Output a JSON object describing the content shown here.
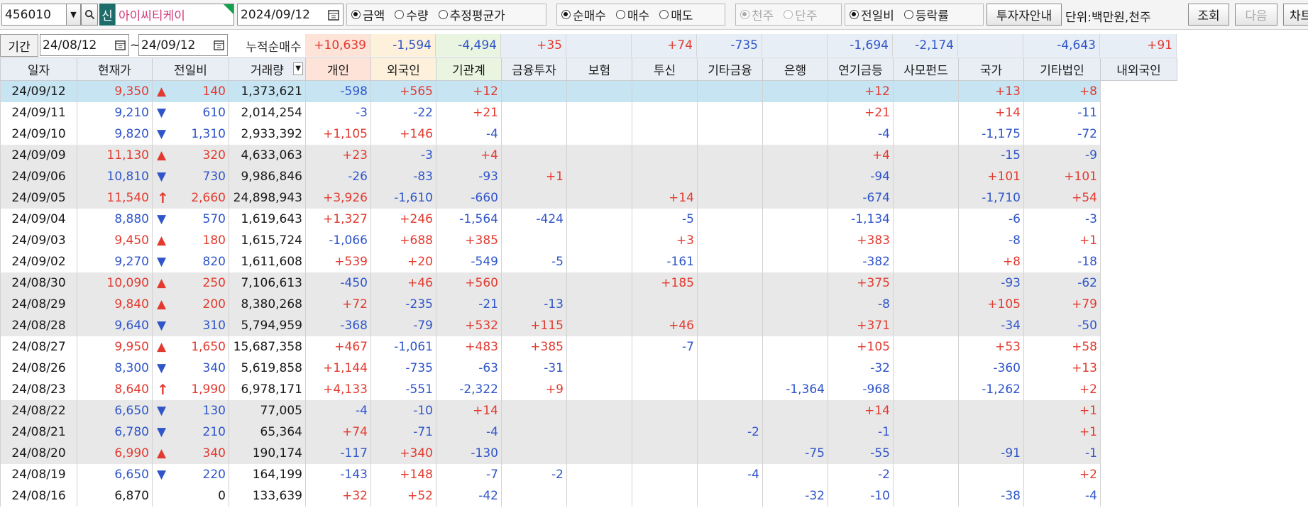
{
  "toolbar": {
    "code": "456010",
    "new_badge": "신",
    "name": "아이씨티케이",
    "date": "2024/09/12",
    "group1": [
      "금액",
      "수량",
      "추정평균가"
    ],
    "group2": [
      "순매수",
      "매수",
      "매도"
    ],
    "group3": [
      "천주",
      "단주"
    ],
    "group4": [
      "전일비",
      "등락률"
    ],
    "invest_btn": "투자자안내",
    "unit": "단위:백만원,천주",
    "query_btn": "조회",
    "next_btn": "다음",
    "chart_btn": "차트"
  },
  "period": {
    "label": "기간",
    "from": "24/08/12",
    "sep": "~",
    "to": "24/09/12",
    "cum_label": "누적순매수"
  },
  "cumulative": [
    "+10,639",
    "-1,594",
    "-4,494",
    "+35",
    "",
    "+74",
    "-735",
    "",
    "-1,694",
    "-2,174",
    "",
    "-4,643",
    "+91"
  ],
  "columns": [
    "일자",
    "현재가",
    "전일비",
    "거래량",
    "개인",
    "외국인",
    "기관계",
    "금융투자",
    "보험",
    "투신",
    "기타금융",
    "은행",
    "연기금등",
    "사모펀드",
    "국가",
    "기타법인",
    "내외국인"
  ],
  "rows": [
    {
      "date": "24/09/12",
      "price": "9,350",
      "dir": "up",
      "chg": "140",
      "vol": "1,373,621",
      "v": [
        "-598",
        "+565",
        "+12",
        "",
        "",
        "",
        "",
        "",
        "+12",
        "",
        "+13",
        "+8"
      ]
    },
    {
      "date": "24/09/11",
      "price": "9,210",
      "dir": "down",
      "chg": "610",
      "vol": "2,014,254",
      "v": [
        "-3",
        "-22",
        "+21",
        "",
        "",
        "",
        "",
        "",
        "+21",
        "",
        "+14",
        "-11"
      ]
    },
    {
      "date": "24/09/10",
      "price": "9,820",
      "dir": "down",
      "chg": "1,310",
      "vol": "2,933,392",
      "v": [
        "+1,105",
        "+146",
        "-4",
        "",
        "",
        "",
        "",
        "",
        "-4",
        "",
        "-1,175",
        "-72"
      ]
    },
    {
      "date": "24/09/09",
      "price": "11,130",
      "dir": "up",
      "chg": "320",
      "vol": "4,633,063",
      "v": [
        "+23",
        "-3",
        "+4",
        "",
        "",
        "",
        "",
        "",
        "+4",
        "",
        "-15",
        "-9"
      ]
    },
    {
      "date": "24/09/06",
      "price": "10,810",
      "dir": "down",
      "chg": "730",
      "vol": "9,986,846",
      "v": [
        "-26",
        "-83",
        "-93",
        "+1",
        "",
        "",
        "",
        "",
        "-94",
        "",
        "+101",
        "+101"
      ]
    },
    {
      "date": "24/09/05",
      "price": "11,540",
      "dir": "limitup",
      "chg": "2,660",
      "vol": "24,898,943",
      "v": [
        "+3,926",
        "-1,610",
        "-660",
        "",
        "",
        "+14",
        "",
        "",
        "-674",
        "",
        "-1,710",
        "+54"
      ]
    },
    {
      "date": "24/09/04",
      "price": "8,880",
      "dir": "down",
      "chg": "570",
      "vol": "1,619,643",
      "v": [
        "+1,327",
        "+246",
        "-1,564",
        "-424",
        "",
        "-5",
        "",
        "",
        "-1,134",
        "",
        "-6",
        "-3"
      ]
    },
    {
      "date": "24/09/03",
      "price": "9,450",
      "dir": "up",
      "chg": "180",
      "vol": "1,615,724",
      "v": [
        "-1,066",
        "+688",
        "+385",
        "",
        "",
        "+3",
        "",
        "",
        "+383",
        "",
        "-8",
        "+1"
      ]
    },
    {
      "date": "24/09/02",
      "price": "9,270",
      "dir": "down",
      "chg": "820",
      "vol": "1,611,608",
      "v": [
        "+539",
        "+20",
        "-549",
        "-5",
        "",
        "-161",
        "",
        "",
        "-382",
        "",
        "+8",
        "-18"
      ]
    },
    {
      "date": "24/08/30",
      "price": "10,090",
      "dir": "up",
      "chg": "250",
      "vol": "7,106,613",
      "v": [
        "-450",
        "+46",
        "+560",
        "",
        "",
        "+185",
        "",
        "",
        "+375",
        "",
        "-93",
        "-62"
      ]
    },
    {
      "date": "24/08/29",
      "price": "9,840",
      "dir": "up",
      "chg": "200",
      "vol": "8,380,268",
      "v": [
        "+72",
        "-235",
        "-21",
        "-13",
        "",
        "",
        "",
        "",
        "-8",
        "",
        "+105",
        "+79"
      ]
    },
    {
      "date": "24/08/28",
      "price": "9,640",
      "dir": "down",
      "chg": "310",
      "vol": "5,794,959",
      "v": [
        "-368",
        "-79",
        "+532",
        "+115",
        "",
        "+46",
        "",
        "",
        "+371",
        "",
        "-34",
        "-50"
      ]
    },
    {
      "date": "24/08/27",
      "price": "9,950",
      "dir": "up",
      "chg": "1,650",
      "vol": "15,687,358",
      "v": [
        "+467",
        "-1,061",
        "+483",
        "+385",
        "",
        "-7",
        "",
        "",
        "+105",
        "",
        "+53",
        "+58"
      ]
    },
    {
      "date": "24/08/26",
      "price": "8,300",
      "dir": "down",
      "chg": "340",
      "vol": "5,619,858",
      "v": [
        "+1,144",
        "-735",
        "-63",
        "-31",
        "",
        "",
        "",
        "",
        "-32",
        "",
        "-360",
        "+13"
      ]
    },
    {
      "date": "24/08/23",
      "price": "8,640",
      "dir": "limitup",
      "chg": "1,990",
      "vol": "6,978,171",
      "v": [
        "+4,133",
        "-551",
        "-2,322",
        "+9",
        "",
        "",
        "",
        "-1,364",
        "-968",
        "",
        "-1,262",
        "+2"
      ]
    },
    {
      "date": "24/08/22",
      "price": "6,650",
      "dir": "down",
      "chg": "130",
      "vol": "77,005",
      "v": [
        "-4",
        "-10",
        "+14",
        "",
        "",
        "",
        "",
        "",
        "+14",
        "",
        "",
        "+1"
      ]
    },
    {
      "date": "24/08/21",
      "price": "6,780",
      "dir": "down",
      "chg": "210",
      "vol": "65,364",
      "v": [
        "+74",
        "-71",
        "-4",
        "",
        "",
        "",
        "-2",
        "",
        "-1",
        "",
        "",
        "+1"
      ]
    },
    {
      "date": "24/08/20",
      "price": "6,990",
      "dir": "up",
      "chg": "340",
      "vol": "190,174",
      "v": [
        "-117",
        "+340",
        "-130",
        "",
        "",
        "",
        "",
        "-75",
        "-55",
        "",
        "-91",
        "-1"
      ]
    },
    {
      "date": "24/08/19",
      "price": "6,650",
      "dir": "down",
      "chg": "220",
      "vol": "164,199",
      "v": [
        "-143",
        "+148",
        "-7",
        "-2",
        "",
        "",
        "-4",
        "",
        "-2",
        "",
        "",
        "+2"
      ]
    },
    {
      "date": "24/08/16",
      "price": "6,870",
      "dir": "none",
      "chg": "0",
      "vol": "133,639",
      "v": [
        "+32",
        "+52",
        "-42",
        "",
        "",
        "",
        "",
        "-32",
        "-10",
        "",
        "-38",
        "-4"
      ]
    }
  ],
  "icons": {
    "up": "triangle-up-icon",
    "down": "triangle-down-icon",
    "limitup": "bold-arrow-up-icon"
  },
  "colors": {
    "up": "#e23a2f",
    "down": "#2f55c9",
    "individual_bg": "#fde3d8",
    "foreign_bg": "#fdf1dc",
    "institution_bg": "#e9f5e1",
    "selected_row": "#c7e4f3",
    "stripe": "#e8e8e8"
  }
}
